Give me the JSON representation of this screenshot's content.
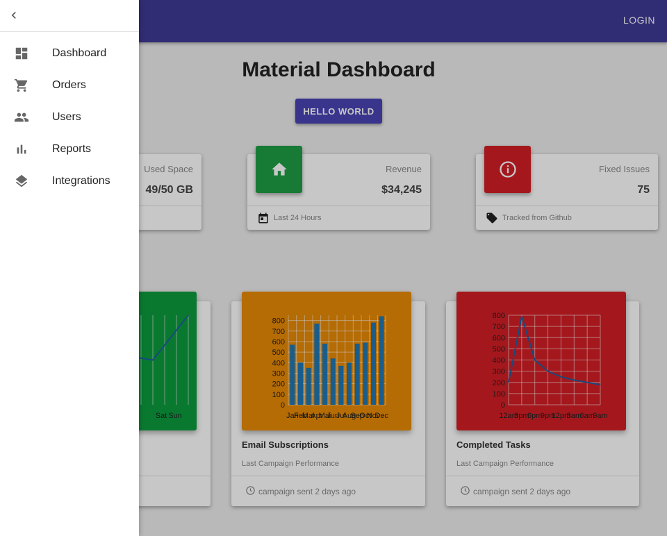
{
  "appbar": {
    "login_label": "LOGIN"
  },
  "main": {
    "title": "Material Dashboard",
    "hello_button": "HELLO WORLD"
  },
  "stats": [
    {
      "label": "Used Space",
      "value": "49/50 GB",
      "footer": "",
      "color": "#1e9e44",
      "icon": "storage-icon"
    },
    {
      "label": "Revenue",
      "value": "$34,245",
      "footer": "Last 24 Hours",
      "color": "#1e9e44",
      "icon": "home-icon",
      "footer_icon": "calendar-icon"
    },
    {
      "label": "Fixed Issues",
      "value": "75",
      "footer": "Tracked from Github",
      "color": "#d21f26",
      "icon": "info-icon",
      "footer_icon": "tag-icon"
    }
  ],
  "charts": [
    {
      "title": "",
      "subtitle": "",
      "footer": "",
      "color": "#0d9c3e",
      "chart_data": {
        "type": "line",
        "categories": [
          "Sat",
          "Sun"
        ],
        "values": [
          450,
          400,
          800
        ]
      }
    },
    {
      "title": "Email Subscriptions",
      "subtitle": "Last Campaign Performance",
      "footer": "campaign sent 2 days ago",
      "color": "#e88b06",
      "chart_data": {
        "type": "bar",
        "categories": [
          "Jan",
          "Feb",
          "Mar",
          "Apr",
          "Mai",
          "Jun",
          "Jul",
          "Aug",
          "Sep",
          "Oct",
          "Nov",
          "Dec"
        ],
        "values": [
          570,
          400,
          350,
          770,
          580,
          440,
          370,
          400,
          580,
          590,
          780,
          840
        ],
        "yticks": [
          0,
          100,
          200,
          300,
          400,
          500,
          600,
          700,
          800
        ],
        "ylim": [
          0,
          850
        ]
      }
    },
    {
      "title": "Completed Tasks",
      "subtitle": "Last Campaign Performance",
      "footer": "campaign sent 2 days ago",
      "color": "#d21f26",
      "chart_data": {
        "type": "line",
        "categories": [
          "12am",
          "3pm",
          "6pm",
          "9pm",
          "12pm",
          "3am",
          "6am",
          "9am"
        ],
        "values": [
          200,
          790,
          400,
          300,
          250,
          220,
          200,
          180
        ],
        "yticks": [
          0,
          100,
          200,
          300,
          400,
          500,
          600,
          700,
          800
        ],
        "ylim": [
          0,
          800
        ]
      }
    }
  ],
  "drawer": {
    "items": [
      {
        "label": "Dashboard",
        "icon": "dashboard-icon"
      },
      {
        "label": "Orders",
        "icon": "cart-icon"
      },
      {
        "label": "Users",
        "icon": "people-icon"
      },
      {
        "label": "Reports",
        "icon": "bar-chart-icon"
      },
      {
        "label": "Integrations",
        "icon": "layers-icon"
      }
    ]
  }
}
